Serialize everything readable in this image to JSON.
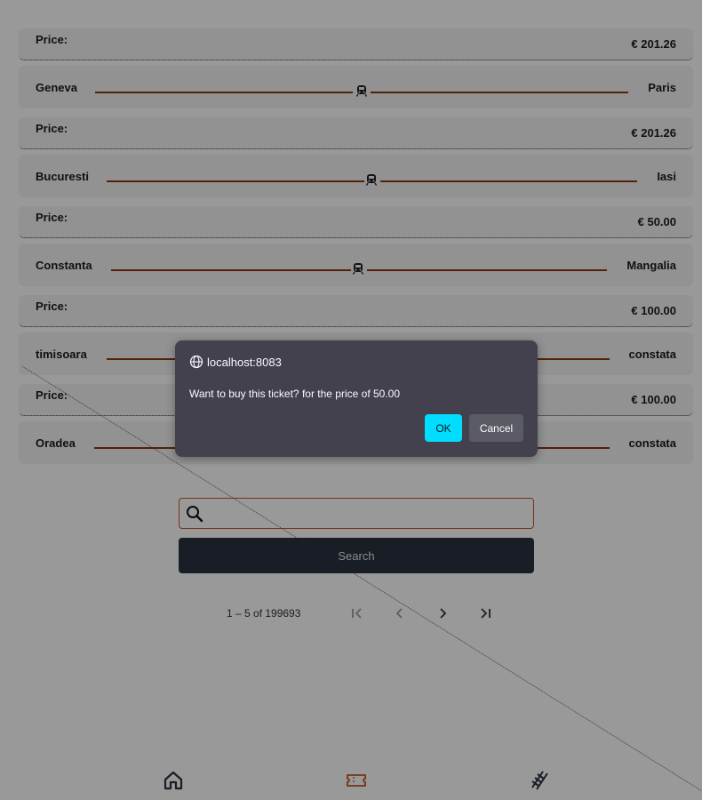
{
  "tickets": [
    {
      "price_label": "Price:",
      "price": "€ 201.26",
      "from": "Geneva",
      "to": "Paris"
    },
    {
      "price_label": "Price:",
      "price": "€ 201.26",
      "from": "Bucuresti",
      "to": "Iasi"
    },
    {
      "price_label": "Price:",
      "price": "€ 50.00",
      "from": "Constanta",
      "to": "Mangalia"
    },
    {
      "price_label": "Price:",
      "price": "€ 100.00",
      "from": "timisoara",
      "to": "constata"
    },
    {
      "price_label": "Price:",
      "price": "€ 100.00",
      "from": "Oradea",
      "to": "constata"
    }
  ],
  "search": {
    "placeholder": "",
    "value": "",
    "button_label": "Search"
  },
  "pager": {
    "range": "1 – 5 of 199693"
  },
  "icons": {
    "search": "magnifier-icon",
    "train": "train-icon",
    "first": "first-page-icon",
    "prev": "prev-page-icon",
    "next": "next-page-icon",
    "last": "last-page-icon",
    "home": "home-icon",
    "tickets": "ticket-icon",
    "rail": "railway-icon"
  },
  "colors": {
    "accent": "#c2571a",
    "track": "#8b3a0f",
    "search_button": "#2a313f",
    "dialog_bg": "#42414d",
    "ok_button": "#00ddff"
  },
  "dialog": {
    "origin": "localhost:8083",
    "message": "Want to buy this ticket? for the price of 50.00",
    "ok_label": "OK",
    "cancel_label": "Cancel"
  }
}
